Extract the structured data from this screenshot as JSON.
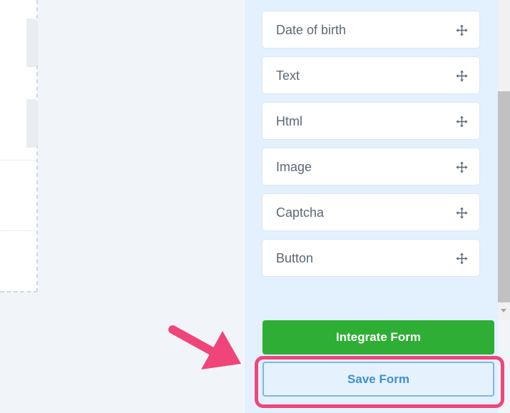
{
  "fields_panel": {
    "items": [
      {
        "label": "Date of birth",
        "icon": "move-icon"
      },
      {
        "label": "Text",
        "icon": "move-icon"
      },
      {
        "label": "Html",
        "icon": "move-icon"
      },
      {
        "label": "Image",
        "icon": "move-icon"
      },
      {
        "label": "Captcha",
        "icon": "move-icon"
      },
      {
        "label": "Button",
        "icon": "move-icon"
      }
    ]
  },
  "actions": {
    "integrate_label": "Integrate Form",
    "save_label": "Save Form"
  },
  "colors": {
    "panel_background": "#e3f0fd",
    "integrate_button": "#2eae34",
    "save_button_text": "#3f8fd0",
    "annotation": "#f0457a"
  }
}
